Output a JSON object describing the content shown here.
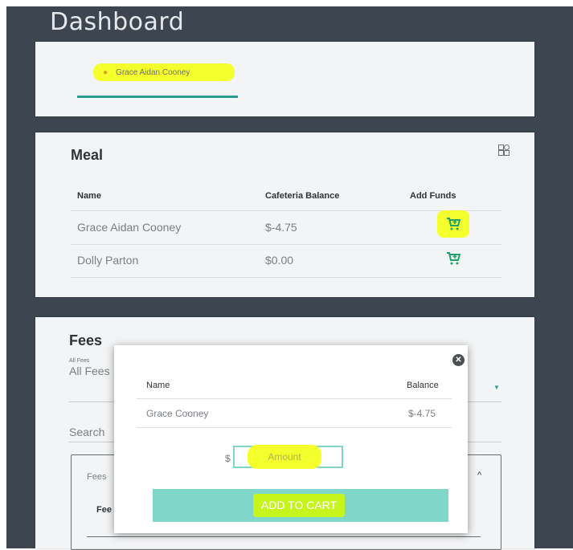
{
  "page": {
    "title": "Dashboard"
  },
  "student_tab": {
    "label": "Grace Aidan Cooney"
  },
  "meal": {
    "title": "Meal",
    "headers": [
      "Name",
      "Cafeteria Balance",
      "Add Funds"
    ],
    "rows": [
      {
        "name": "Grace Aidan Cooney",
        "balance": "$-4.75"
      },
      {
        "name": "Dolly  Parton",
        "balance": "$0.00"
      }
    ],
    "cart_icon": "cart-plus-icon"
  },
  "fees": {
    "title": "Fees",
    "filter_small_label": "All Fees",
    "filter_value": "All Fees",
    "search_label": "Search",
    "inner_title": "Fees",
    "fee_column": "Fee"
  },
  "modal": {
    "headers": [
      "Name",
      "Balance"
    ],
    "row": {
      "name": "Grace Cooney",
      "balance": "$-4.75"
    },
    "currency": "$",
    "amount_placeholder": "Amount",
    "add_button": "ADD TO CART",
    "close_icon": "close-icon"
  },
  "colors": {
    "background": "#3c4550",
    "accent": "#2a9d8f",
    "button": "#80d6c8",
    "highlight": "#f5ff2b",
    "cart": "#22a06b"
  }
}
